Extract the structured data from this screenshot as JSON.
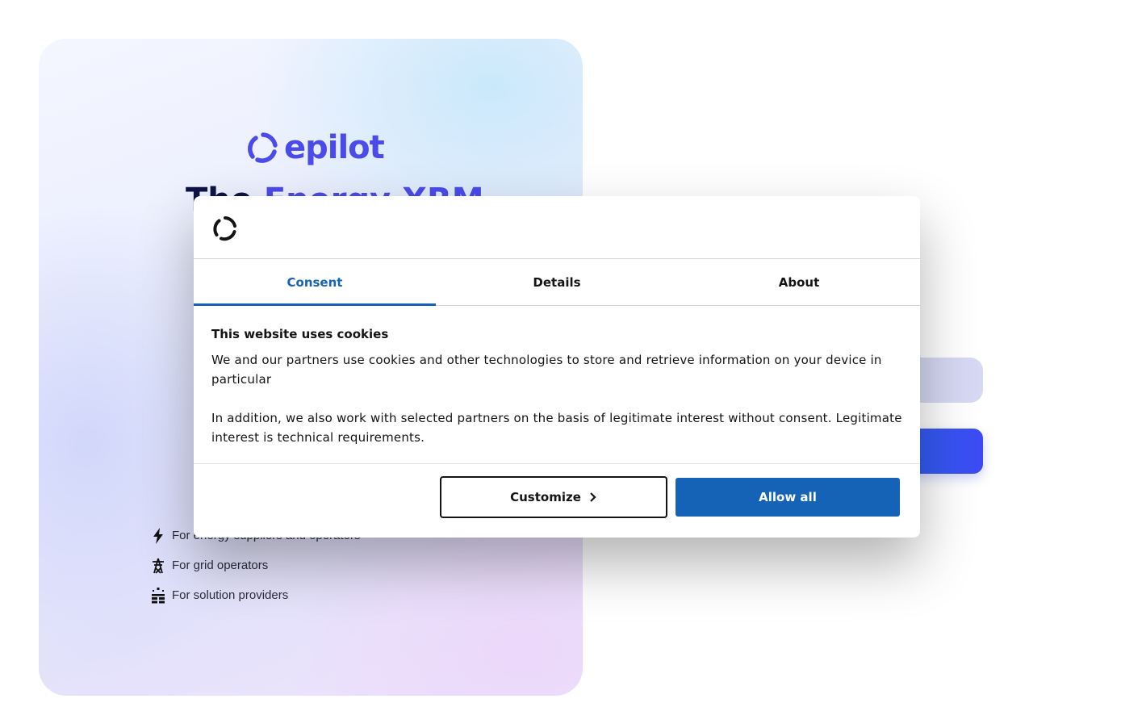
{
  "hero": {
    "logo_text": "epilot",
    "headline_part1": "The ",
    "headline_part2": "Energy XRM",
    "features": [
      {
        "icon": "lightning-icon",
        "label": "For energy suppliers and operators"
      },
      {
        "icon": "power-tower-icon",
        "label": "For grid operators"
      },
      {
        "icon": "solar-panel-icon",
        "label": "For solution providers"
      }
    ]
  },
  "consent_dialog": {
    "tabs": [
      {
        "label": "Consent",
        "active": true
      },
      {
        "label": "Details",
        "active": false
      },
      {
        "label": "About",
        "active": false
      }
    ],
    "title": "This website uses cookies",
    "paragraph_1": "We and our partners use cookies and other technologies to store and retrieve information on your device in particular",
    "paragraph_2": "In addition, we also work with selected partners on the basis of legitimate interest without consent. Legitimate interest is technical requirements.",
    "customize_label": "Customize",
    "allow_all_label": "Allow all"
  },
  "colors": {
    "brand": "#4b4bea",
    "consent_accent": "#1563b6",
    "login_button": "#3d4af3"
  }
}
